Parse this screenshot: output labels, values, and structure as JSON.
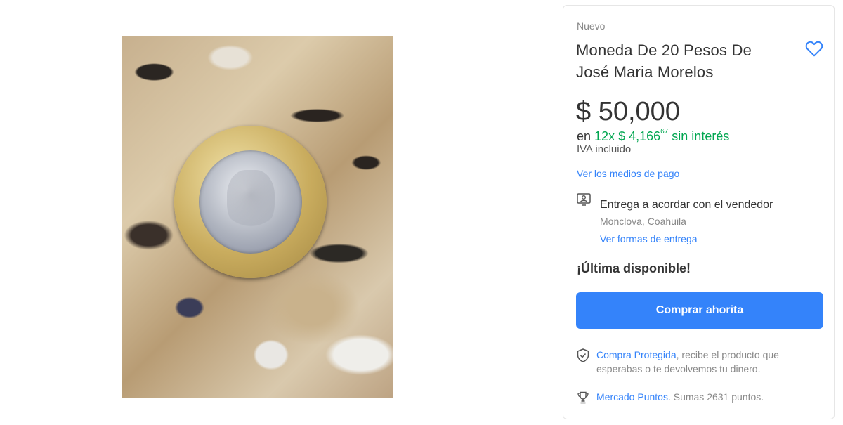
{
  "gallery": {
    "image_alt": "Moneda bimetálica sobre superficie de granito"
  },
  "product": {
    "condition": "Nuevo",
    "title": "Moneda De 20 Pesos De José Maria Morelos",
    "price": "$ 50,000",
    "installments_prefix": "en",
    "installments_count": "12x",
    "installments_amount": "$ 4,166",
    "installments_cents": "67",
    "installments_suffix": "sin interés",
    "tax_note": "IVA incluido",
    "payment_link": "Ver los medios de pago"
  },
  "delivery": {
    "title": "Entrega a acordar con el vendedor",
    "location": "Monclova, Coahuila",
    "link": "Ver formas de entrega"
  },
  "stock": {
    "label": "¡Última disponible!"
  },
  "actions": {
    "buy_label": "Comprar ahorita"
  },
  "protection": {
    "link": "Compra Protegida",
    "text": ", recibe el producto que esperabas o te devolvemos tu dinero."
  },
  "points": {
    "link": "Mercado Puntos",
    "text": ". Sumas 2631 puntos."
  },
  "icons": {
    "favorite": "heart-outline-icon",
    "delivery": "person-badge-icon",
    "protection": "shield-check-icon",
    "points": "trophy-icon"
  },
  "colors": {
    "accent": "#3483fa",
    "installments": "#00a650",
    "text": "#333333",
    "muted": "#888888"
  }
}
